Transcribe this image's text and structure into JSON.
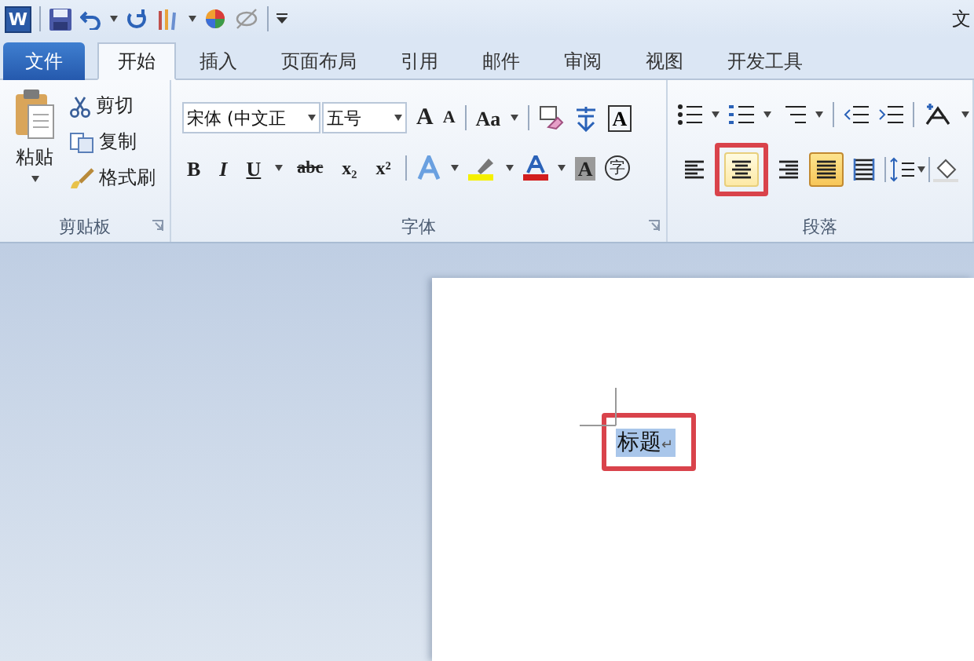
{
  "quick_access": {
    "logo_letter": "W",
    "title": "文"
  },
  "tabs": [
    {
      "label": "文件",
      "kind": "file",
      "selected": false
    },
    {
      "label": "开始",
      "kind": "tab",
      "selected": true
    },
    {
      "label": "插入",
      "kind": "tab",
      "selected": false
    },
    {
      "label": "页面布局",
      "kind": "tab",
      "selected": false
    },
    {
      "label": "引用",
      "kind": "tab",
      "selected": false
    },
    {
      "label": "邮件",
      "kind": "tab",
      "selected": false
    },
    {
      "label": "审阅",
      "kind": "tab",
      "selected": false
    },
    {
      "label": "视图",
      "kind": "tab",
      "selected": false
    },
    {
      "label": "开发工具",
      "kind": "tab",
      "selected": false
    }
  ],
  "clipboard": {
    "label": "剪贴板",
    "paste": "粘贴",
    "items": [
      {
        "kind": "cut",
        "label": "剪切"
      },
      {
        "kind": "copy",
        "label": "复制"
      },
      {
        "kind": "painter",
        "label": "格式刷"
      }
    ]
  },
  "font": {
    "label": "字体",
    "font_name": "宋体 (中文正",
    "font_size": "五号",
    "grow": "A",
    "shrink": "A",
    "change_case": "Aa",
    "boxed": "A",
    "shaded": "A",
    "enclosed": "字",
    "format_buttons": [
      {
        "kind": "bold",
        "label": "B"
      },
      {
        "kind": "italic",
        "label": "I"
      },
      {
        "kind": "underline",
        "label": "U"
      },
      {
        "kind": "strike",
        "label": "abc"
      },
      {
        "kind": "sub",
        "label": "x₂"
      },
      {
        "kind": "sup",
        "label": "x²"
      }
    ]
  },
  "paragraph": {
    "label": "段落",
    "align_buttons": [
      {
        "kind": "left",
        "selected": false,
        "hovered": false,
        "marked": false
      },
      {
        "kind": "center",
        "selected": false,
        "hovered": true,
        "marked": true
      },
      {
        "kind": "right",
        "selected": false,
        "hovered": false,
        "marked": false
      },
      {
        "kind": "justify",
        "selected": true,
        "hovered": false,
        "marked": false
      },
      {
        "kind": "distributed",
        "selected": false,
        "hovered": false,
        "marked": false
      }
    ]
  },
  "document": {
    "text": "标题",
    "paragraph_mark": "↵",
    "selected": true,
    "marked": true
  }
}
